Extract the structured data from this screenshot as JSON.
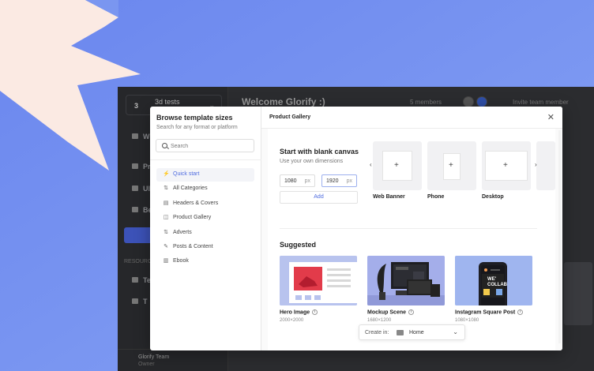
{
  "app": {
    "workspace_number": "3",
    "workspace_name": "3d tests",
    "page_title": "Welcome Glorify :)",
    "members": "5 members",
    "invite": "Invite team member",
    "sidebar_items": [
      "W",
      "Pr",
      "Ul",
      "Be",
      "Te",
      "T"
    ],
    "resources_label": "RESOURCES",
    "team_name": "Glorify Team",
    "team_sub": "Owner"
  },
  "modal": {
    "sidebar": {
      "title": "Browse template sizes",
      "subtitle": "Search for any format or platform",
      "search_placeholder": "Search",
      "nav": [
        {
          "label": "Quick start",
          "icon": "lightning-icon",
          "glyph": "⚡",
          "active": true
        },
        {
          "label": "All Categories",
          "icon": "sort-icon",
          "glyph": "⇅",
          "active": false
        },
        {
          "label": "Headers & Covers",
          "icon": "layout-icon",
          "glyph": "▤",
          "active": false
        },
        {
          "label": "Product Gallery",
          "icon": "bag-icon",
          "glyph": "◫",
          "active": false
        },
        {
          "label": "Adverts",
          "icon": "sort-icon",
          "glyph": "⇅",
          "active": false
        },
        {
          "label": "Posts & Content",
          "icon": "pen-icon",
          "glyph": "✎",
          "active": false
        },
        {
          "label": "Ebook",
          "icon": "book-icon",
          "glyph": "▥",
          "active": false
        }
      ]
    },
    "header_title": "Product Gallery",
    "blank": {
      "title": "Start with blank canvas",
      "subtitle": "Use your own dimensions",
      "width": "1080",
      "height": "1920",
      "unit": "px",
      "add_label": "Add",
      "templates": [
        {
          "label": "Web Banner"
        },
        {
          "label": "Phone"
        },
        {
          "label": "Desktop"
        }
      ],
      "plus": "+"
    },
    "suggested": {
      "title": "Suggested",
      "cards": [
        {
          "name": "Hero Image",
          "size": "2000×2000"
        },
        {
          "name": "Mockup Scene",
          "size": "1680×1200"
        },
        {
          "name": "Instagram Square Post",
          "size": "1080×1080"
        }
      ],
      "instagram_text": "WE' COLLAB"
    },
    "create_in": {
      "label": "Create in:",
      "value": "Home"
    },
    "colors": {
      "accent": "#4f6ce0",
      "background": "#6f8ff0",
      "card": "#b8c3ee"
    }
  }
}
